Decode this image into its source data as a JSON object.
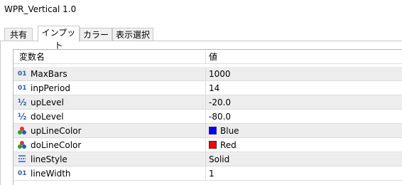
{
  "window": {
    "title": "WPR_Vertical 1.0"
  },
  "tabs": [
    {
      "label": "共有"
    },
    {
      "label": "インプット"
    },
    {
      "label": "カラー"
    },
    {
      "label": "表示選択"
    }
  ],
  "table": {
    "headers": {
      "name": "変数名",
      "value": "値"
    },
    "rows": [
      {
        "icon": "integer-icon",
        "name": "MaxBars",
        "value": "1000"
      },
      {
        "icon": "integer-icon",
        "name": "inpPeriod",
        "value": "14"
      },
      {
        "icon": "fraction-icon",
        "name": "upLevel",
        "value": "-20.0"
      },
      {
        "icon": "fraction-icon",
        "name": "doLevel",
        "value": "-80.0"
      },
      {
        "icon": "color-icon",
        "name": "upLineColor",
        "value": "Blue",
        "swatch": "#0000ff"
      },
      {
        "icon": "color-icon",
        "name": "doLineColor",
        "value": "Red",
        "swatch": "#ff0000"
      },
      {
        "icon": "line-style-icon",
        "name": "lineStyle",
        "value": "Solid"
      },
      {
        "icon": "integer-icon",
        "name": "lineWidth",
        "value": "1"
      }
    ]
  }
}
